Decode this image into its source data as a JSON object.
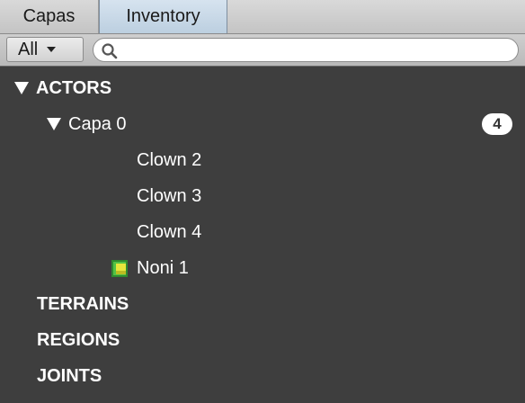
{
  "tabs": [
    {
      "label": "Capas",
      "active": false
    },
    {
      "label": "Inventory",
      "active": true
    }
  ],
  "filter": {
    "selected": "All",
    "search_value": "",
    "search_placeholder": ""
  },
  "tree": {
    "actors": {
      "label": "ACTORS",
      "expanded": true,
      "layers": [
        {
          "label": "Capa 0",
          "expanded": true,
          "count": "4",
          "items": [
            {
              "label": "Clown 2",
              "icon": null
            },
            {
              "label": "Clown 3",
              "icon": null
            },
            {
              "label": "Clown 4",
              "icon": null
            },
            {
              "label": "Noni 1",
              "icon": "green-actor-icon"
            }
          ]
        }
      ]
    },
    "terrains": {
      "label": "TERRAINS"
    },
    "regions": {
      "label": "REGIONS"
    },
    "joints": {
      "label": "JOINTS"
    }
  },
  "colors": {
    "background": "#3e3e3e",
    "active_tab": "#c8d8e8",
    "icon_green": "#3fa33a",
    "icon_yellow": "#e8e83a"
  }
}
